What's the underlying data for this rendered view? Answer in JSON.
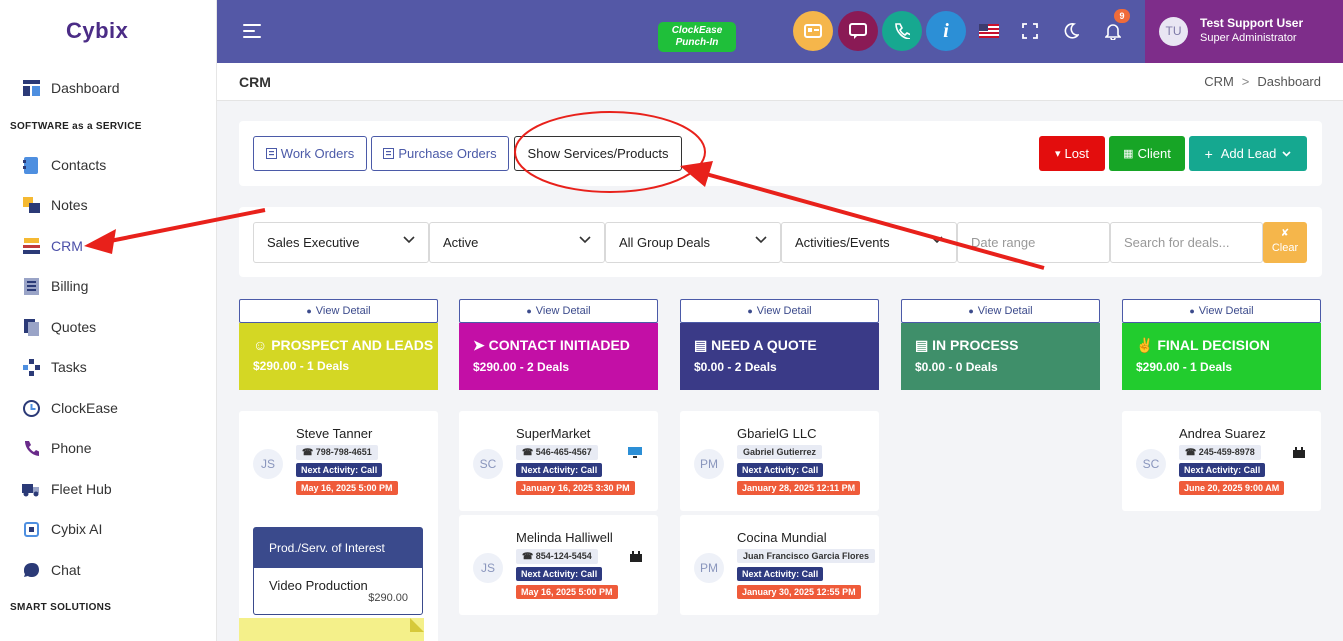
{
  "app": {
    "logo": "Cybix"
  },
  "sidebar": {
    "items": [
      {
        "label": "Dashboard",
        "icon": "dashboard-icon"
      },
      {
        "label": "Contacts",
        "icon": "contacts-icon"
      },
      {
        "label": "Notes",
        "icon": "notes-icon"
      },
      {
        "label": "CRM",
        "icon": "crm-icon"
      },
      {
        "label": "Billing",
        "icon": "billing-icon"
      },
      {
        "label": "Quotes",
        "icon": "quotes-icon"
      },
      {
        "label": "Tasks",
        "icon": "tasks-icon"
      },
      {
        "label": "ClockEase",
        "icon": "clock-icon"
      },
      {
        "label": "Phone",
        "icon": "phone-icon"
      },
      {
        "label": "Fleet Hub",
        "icon": "truck-icon"
      },
      {
        "label": "Cybix AI",
        "icon": "ai-icon"
      },
      {
        "label": "Chat",
        "icon": "chat-icon"
      }
    ],
    "section_saas": "SOFTWARE as a SERVICE",
    "section_smart": "SMART SOLUTIONS"
  },
  "topbar": {
    "clock_line1": "ClockEase",
    "clock_line2": "Punch-In",
    "notif_count": "9",
    "user_initials": "TU",
    "user_name": "Test Support User",
    "user_role": "Super Administrator",
    "info_glyph": "i"
  },
  "page": {
    "title": "CRM",
    "breadcrumb": [
      "CRM",
      "Dashboard"
    ]
  },
  "toolbar": {
    "work_orders": "Work Orders",
    "purchase_orders": "Purchase Orders",
    "show_services": "Show Services/Products",
    "lost": "Lost",
    "client": "Client",
    "add_lead": "Add Lead"
  },
  "filters": {
    "sales_exec": "Sales Executive",
    "status": "Active",
    "group": "All Group Deals",
    "activities": "Activities/Events",
    "date_placeholder": "Date range",
    "search_placeholder": "Search for deals...",
    "clear": "Clear"
  },
  "view_detail": "View Detail",
  "stages": [
    {
      "title": "PROSPECT AND LEADS",
      "summary": "$290.00 - 1 Deals",
      "color": "#d4d724"
    },
    {
      "title": "CONTACT INITIADED",
      "summary": "$290.00 - 2 Deals",
      "color": "#c30fa6"
    },
    {
      "title": "NEED A QUOTE",
      "summary": "$0.00 - 2 Deals",
      "color": "#3a3a87"
    },
    {
      "title": "IN PROCESS",
      "summary": "$0.00 - 0 Deals",
      "color": "#3f8f6a"
    },
    {
      "title": "FINAL DECISION",
      "summary": "$290.00 - 1 Deals",
      "color": "#22cc2e"
    }
  ],
  "deals": {
    "d1": {
      "initials": "JS",
      "name": "Steve Tanner",
      "sub": "798-798-4651",
      "activity": "Next Activity: Call",
      "date": "May 16, 2025 5:00 PM"
    },
    "d2": {
      "initials": "SC",
      "name": "SuperMarket",
      "sub": "546-465-4567",
      "activity": "Next Activity: Call",
      "date": "January 16, 2025 3:30 PM"
    },
    "d3": {
      "initials": "JS",
      "name": "Melinda Halliwell",
      "sub": "854-124-5454",
      "activity": "Next Activity: Call",
      "date": "May 16, 2025 5:00 PM"
    },
    "d4": {
      "initials": "PM",
      "name": "GbarielG LLC",
      "sub": "Gabriel Gutierrez",
      "activity": "Next Activity: Call",
      "date": "January 28, 2025 12:11 PM"
    },
    "d5": {
      "initials": "PM",
      "name": "Cocina Mundial",
      "sub": "Juan Francisco Garcia Flores",
      "activity": "Next Activity: Call",
      "date": "January 30, 2025 12:55 PM"
    },
    "d6": {
      "initials": "SC",
      "name": "Andrea Suarez",
      "sub": "245-459-8978",
      "activity": "Next Activity: Call",
      "date": "June 20, 2025 9:00 AM"
    }
  },
  "product": {
    "header": "Prod./Serv. of Interest",
    "name": "Video Production",
    "price": "$290.00"
  },
  "colors": {
    "topbar": "#5458a6",
    "user_bg": "#7e2d8a",
    "lost": "#e30d0d",
    "client": "#17a526",
    "add_lead": "#15a890",
    "annotation": "#e8211b"
  }
}
